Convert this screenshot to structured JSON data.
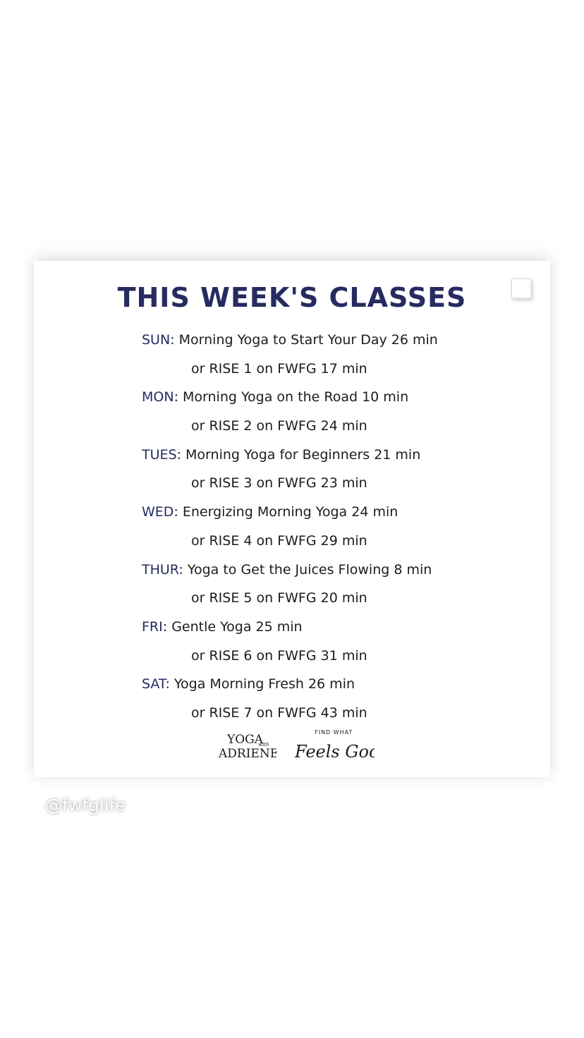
{
  "card": {
    "title": "THIS WEEK'S CLASSES",
    "schedule": [
      {
        "day": "SUN",
        "class": "Morning Yoga to Start Your Day 26 min",
        "alt": "or RISE 1 on FWFG 17 min"
      },
      {
        "day": "MON",
        "class": "Morning Yoga on the Road 10 min",
        "alt": "or RISE 2 on FWFG 24 min"
      },
      {
        "day": "TUES",
        "class": "Morning Yoga for Beginners 21 min",
        "alt": "or RISE 3 on FWFG 23 min"
      },
      {
        "day": "WED",
        "class": "Energizing Morning Yoga 24 min",
        "alt": "or RISE 4 on FWFG 29 min"
      },
      {
        "day": "THUR",
        "class": "Yoga to Get the Juices Flowing 8 min",
        "alt": "or RISE 5 on FWFG 20 min"
      },
      {
        "day": "FRI",
        "class": "Gentle Yoga 25 min",
        "alt": "or RISE 6 on FWFG 31 min"
      },
      {
        "day": "SAT",
        "class": "Yoga Morning Fresh 26 min",
        "alt": "or RISE 7 on FWFG 43 min"
      }
    ],
    "logos": {
      "yoga_with_adriene": {
        "line1": "YOGA",
        "with": "with",
        "line2": "ADRIENE"
      },
      "fwfg": {
        "small": "FIND WHAT",
        "script": "Feels Good"
      }
    }
  },
  "handle": "@fwfglife",
  "colors": {
    "title": "#262b60",
    "day": "#262b60",
    "body_text": "#1c1c1c",
    "background": "#ffffff"
  }
}
